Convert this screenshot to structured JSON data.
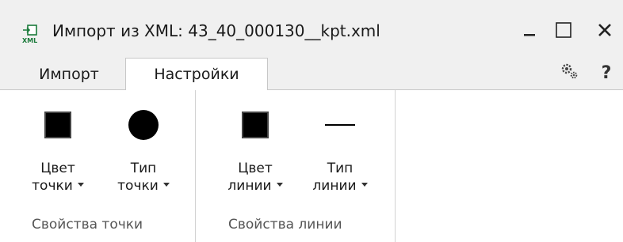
{
  "window": {
    "title": "Импорт из XML: 43_40_000130__kpt.xml",
    "icon": "xml-import-icon"
  },
  "tabs": [
    {
      "label": "Импорт",
      "active": false
    },
    {
      "label": "Настройки",
      "active": true
    }
  ],
  "groups": [
    {
      "label": "Свойства точки",
      "controls": [
        {
          "line1": "Цвет",
          "line2": "точки",
          "icon": "filled-square-icon",
          "color": "#000000"
        },
        {
          "line1": "Тип",
          "line2": "точки",
          "icon": "filled-circle-icon"
        }
      ]
    },
    {
      "label": "Свойства линии",
      "controls": [
        {
          "line1": "Цвет",
          "line2": "линии",
          "icon": "filled-square-icon",
          "color": "#000000"
        },
        {
          "line1": "Тип",
          "line2": "линии",
          "icon": "solid-line-icon"
        }
      ]
    }
  ],
  "toolbar_right": {
    "settings_icon": "gears-icon",
    "help_label": "?"
  }
}
